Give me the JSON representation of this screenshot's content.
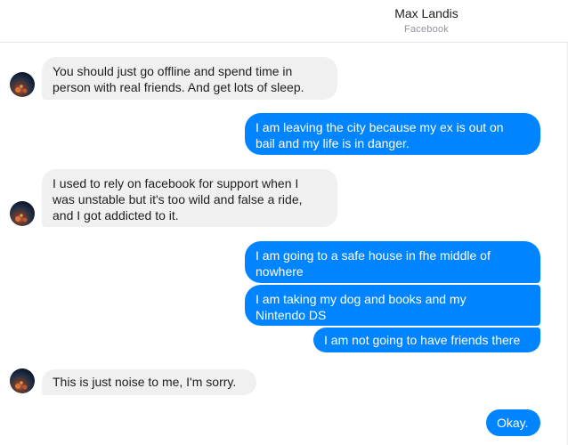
{
  "header": {
    "contact_name": "Max Landis",
    "subtitle": "Facebook"
  },
  "messages": [
    {
      "sender": "contact",
      "lines": [
        "You should just go offline and spend time in",
        "person with real friends.  And get lots of sleep."
      ]
    },
    {
      "sender": "self",
      "lines": [
        "I am leaving the city because my ex is out on",
        "bail and my life is in danger."
      ]
    },
    {
      "sender": "contact",
      "lines": [
        "I used to rely on facebook for support when I",
        "was unstable but it's too wild and false a ride,",
        "and I got addicted to it."
      ]
    },
    {
      "sender": "self",
      "lines": [
        "I am going to a safe house in fhe middle of",
        "nowhere"
      ]
    },
    {
      "sender": "self",
      "lines": [
        "I am taking my dog and books and my",
        "Nintendo DS"
      ]
    },
    {
      "sender": "self",
      "lines": [
        "I am not going to have friends there"
      ]
    },
    {
      "sender": "contact",
      "lines": [
        "This is just noise to me, I'm sorry."
      ]
    },
    {
      "sender": "self",
      "lines": [
        "Okay."
      ]
    }
  ],
  "colors": {
    "outgoing_bubble": "#0084ff",
    "incoming_bubble": "#f1f0f0"
  },
  "icons": {
    "avatar": "contact-avatar-photo"
  }
}
